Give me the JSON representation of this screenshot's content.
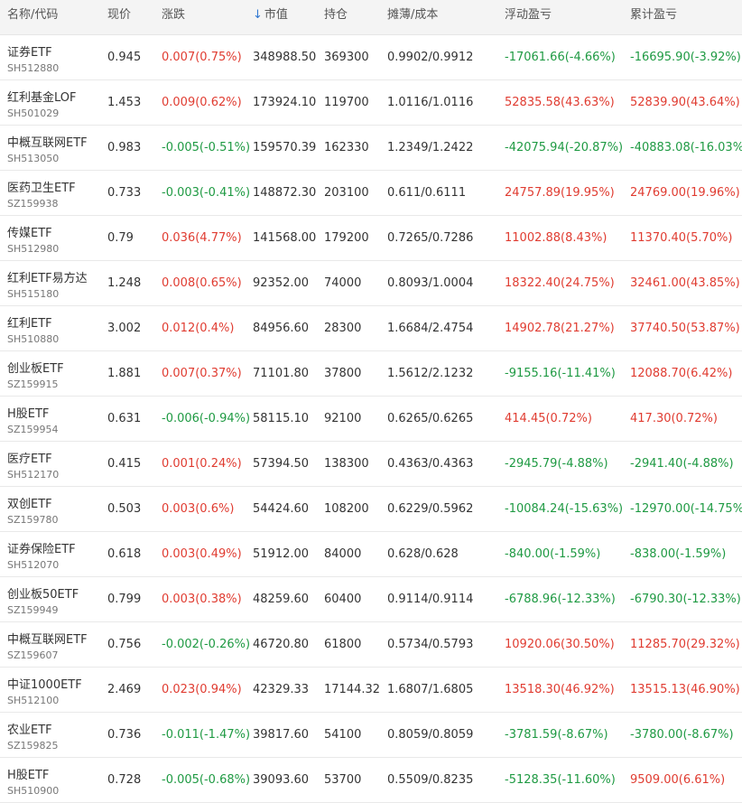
{
  "colors": {
    "up": "#e03c31",
    "down": "#1f9a43",
    "sort_arrow": "#2f77d1"
  },
  "header": {
    "name": "名称/代码",
    "price": "现价",
    "change": "涨跌",
    "market_value": "市值",
    "market_value_sort_icon": "arrow-down-icon",
    "holding": "持仓",
    "cost": "摊薄/成本",
    "float_pnl": "浮动盈亏",
    "total_pnl": "累计盈亏"
  },
  "rows": [
    {
      "name": "证券ETF",
      "code": "SH512880",
      "price": "0.945",
      "change": "0.007(0.75%)",
      "market_value": "348988.50",
      "holding": "369300",
      "cost": "0.9902/0.9912",
      "float_pnl": "-17061.66(-4.66%)",
      "total_pnl": "-16695.90(-3.92%)"
    },
    {
      "name": "红利基金LOF",
      "code": "SH501029",
      "price": "1.453",
      "change": "0.009(0.62%)",
      "market_value": "173924.10",
      "holding": "119700",
      "cost": "1.0116/1.0116",
      "float_pnl": "52835.58(43.63%)",
      "total_pnl": "52839.90(43.64%)"
    },
    {
      "name": "中概互联网ETF",
      "code": "SH513050",
      "price": "0.983",
      "change": "-0.005(-0.51%)",
      "market_value": "159570.39",
      "holding": "162330",
      "cost": "1.2349/1.2422",
      "float_pnl": "-42075.94(-20.87%)",
      "total_pnl": "-40883.08(-16.03%)"
    },
    {
      "name": "医药卫生ETF",
      "code": "SZ159938",
      "price": "0.733",
      "change": "-0.003(-0.41%)",
      "market_value": "148872.30",
      "holding": "203100",
      "cost": "0.611/0.6111",
      "float_pnl": "24757.89(19.95%)",
      "total_pnl": "24769.00(19.96%)"
    },
    {
      "name": "传媒ETF",
      "code": "SH512980",
      "price": "0.79",
      "change": "0.036(4.77%)",
      "market_value": "141568.00",
      "holding": "179200",
      "cost": "0.7265/0.7286",
      "float_pnl": "11002.88(8.43%)",
      "total_pnl": "11370.40(5.70%)"
    },
    {
      "name": "红利ETF易方达",
      "code": "SH515180",
      "price": "1.248",
      "change": "0.008(0.65%)",
      "market_value": "92352.00",
      "holding": "74000",
      "cost": "0.8093/1.0004",
      "float_pnl": "18322.40(24.75%)",
      "total_pnl": "32461.00(43.85%)"
    },
    {
      "name": "红利ETF",
      "code": "SH510880",
      "price": "3.002",
      "change": "0.012(0.4%)",
      "market_value": "84956.60",
      "holding": "28300",
      "cost": "1.6684/2.4754",
      "float_pnl": "14902.78(21.27%)",
      "total_pnl": "37740.50(53.87%)"
    },
    {
      "name": "创业板ETF",
      "code": "SZ159915",
      "price": "1.881",
      "change": "0.007(0.37%)",
      "market_value": "71101.80",
      "holding": "37800",
      "cost": "1.5612/2.1232",
      "float_pnl": "-9155.16(-11.41%)",
      "total_pnl": "12088.70(6.42%)"
    },
    {
      "name": "H股ETF",
      "code": "SZ159954",
      "price": "0.631",
      "change": "-0.006(-0.94%)",
      "market_value": "58115.10",
      "holding": "92100",
      "cost": "0.6265/0.6265",
      "float_pnl": "414.45(0.72%)",
      "total_pnl": "417.30(0.72%)"
    },
    {
      "name": "医疗ETF",
      "code": "SH512170",
      "price": "0.415",
      "change": "0.001(0.24%)",
      "market_value": "57394.50",
      "holding": "138300",
      "cost": "0.4363/0.4363",
      "float_pnl": "-2945.79(-4.88%)",
      "total_pnl": "-2941.40(-4.88%)"
    },
    {
      "name": "双创ETF",
      "code": "SZ159780",
      "price": "0.503",
      "change": "0.003(0.6%)",
      "market_value": "54424.60",
      "holding": "108200",
      "cost": "0.6229/0.5962",
      "float_pnl": "-10084.24(-15.63%)",
      "total_pnl": "-12970.00(-14.75%)"
    },
    {
      "name": "证券保险ETF",
      "code": "SH512070",
      "price": "0.618",
      "change": "0.003(0.49%)",
      "market_value": "51912.00",
      "holding": "84000",
      "cost": "0.628/0.628",
      "float_pnl": "-840.00(-1.59%)",
      "total_pnl": "-838.00(-1.59%)"
    },
    {
      "name": "创业板50ETF",
      "code": "SZ159949",
      "price": "0.799",
      "change": "0.003(0.38%)",
      "market_value": "48259.60",
      "holding": "60400",
      "cost": "0.9114/0.9114",
      "float_pnl": "-6788.96(-12.33%)",
      "total_pnl": "-6790.30(-12.33%)"
    },
    {
      "name": "中概互联网ETF",
      "code": "SZ159607",
      "price": "0.756",
      "change": "-0.002(-0.26%)",
      "market_value": "46720.80",
      "holding": "61800",
      "cost": "0.5734/0.5793",
      "float_pnl": "10920.06(30.50%)",
      "total_pnl": "11285.70(29.32%)"
    },
    {
      "name": "中证1000ETF",
      "code": "SH512100",
      "price": "2.469",
      "change": "0.023(0.94%)",
      "market_value": "42329.33",
      "holding": "17144.32",
      "cost": "1.6807/1.6805",
      "float_pnl": "13518.30(46.92%)",
      "total_pnl": "13515.13(46.90%)"
    },
    {
      "name": "农业ETF",
      "code": "SZ159825",
      "price": "0.736",
      "change": "-0.011(-1.47%)",
      "market_value": "39817.60",
      "holding": "54100",
      "cost": "0.8059/0.8059",
      "float_pnl": "-3781.59(-8.67%)",
      "total_pnl": "-3780.00(-8.67%)"
    },
    {
      "name": "H股ETF",
      "code": "SH510900",
      "price": "0.728",
      "change": "-0.005(-0.68%)",
      "market_value": "39093.60",
      "holding": "53700",
      "cost": "0.5509/0.8235",
      "float_pnl": "-5128.35(-11.60%)",
      "total_pnl": "9509.00(6.61%)"
    }
  ]
}
